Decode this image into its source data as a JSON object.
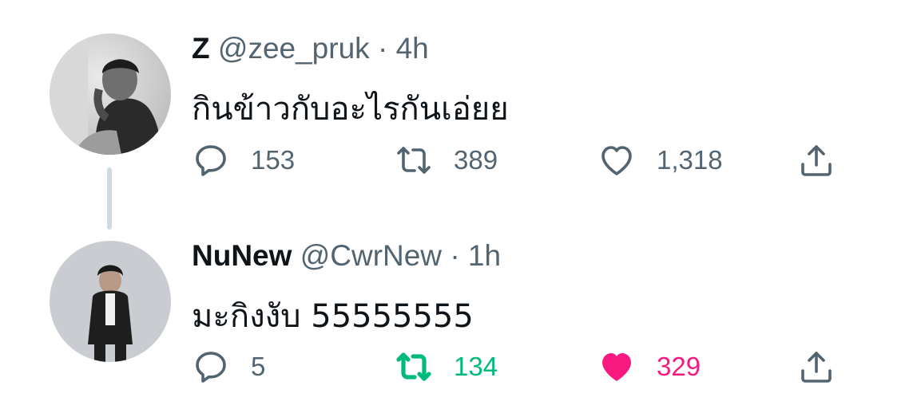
{
  "tweets": [
    {
      "name": "Z",
      "handle": "@zee_pruk",
      "separator": "·",
      "time": "4h",
      "text": "กินข้าวกับอะไรกันเอ่ยย",
      "replies": "153",
      "retweets": "389",
      "likes": "1,318",
      "retweeted": false,
      "liked": false
    },
    {
      "name": "NuNew",
      "handle": "@CwrNew",
      "separator": "·",
      "time": "1h",
      "text": "มะกิงงับ 55555555",
      "replies": "5",
      "retweets": "134",
      "likes": "329",
      "retweeted": true,
      "liked": true
    }
  ],
  "icons": {
    "reply": "speech-bubble-icon",
    "retweet": "retweet-icon",
    "like": "heart-icon",
    "share": "share-upload-icon"
  },
  "colors": {
    "text": "#0f1419",
    "secondary": "#536471",
    "retweet_active": "#00ba7c",
    "like_active": "#f91880",
    "thread_line": "#cfd9de"
  }
}
